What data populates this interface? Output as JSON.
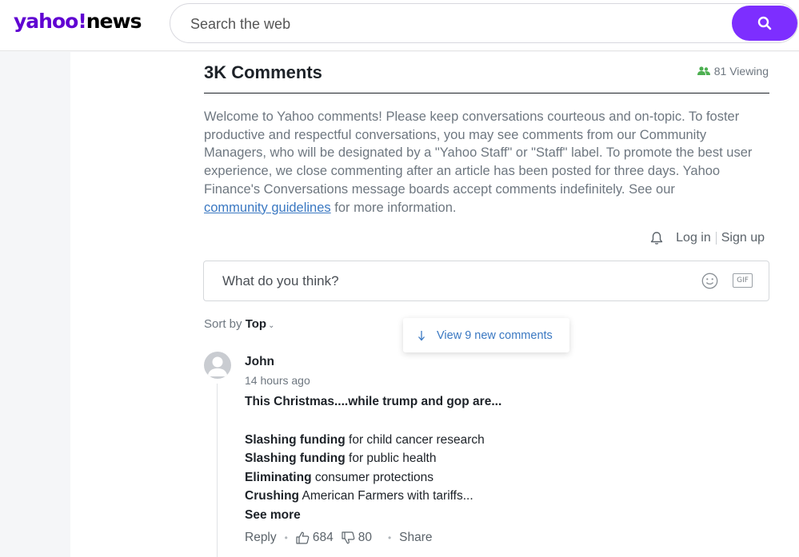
{
  "header": {
    "logo_brand": "yahoo!",
    "logo_section": "news",
    "search_placeholder": "Search the web"
  },
  "comments": {
    "title": "3K Comments",
    "viewing": "81 Viewing",
    "welcome_text": "Welcome to Yahoo comments! Please keep conversations courteous and on-topic. To foster productive and respectful conversations, you may see comments from our Community Managers, who will be designated by a \"Yahoo Staff\" or \"Staff\" label. To promote the best user experience, we close commenting after an article has been posted for three days. Yahoo Finance's Conversations message boards accept comments indefinitely. See our",
    "guidelines_link": "community guidelines",
    "welcome_suffix": "for more information.",
    "login": "Log in",
    "signup": "Sign up",
    "composer_placeholder": "What do you think?",
    "gif_label": "GIF",
    "sort_label": "Sort by",
    "sort_value": "Top",
    "new_comments": "View 9 new comments"
  },
  "comment": {
    "author": "John",
    "time": "14 hours ago",
    "line1": "This Christmas....while trump and gop are...",
    "items": [
      {
        "bold": "Slashing funding",
        "rest": "for child cancer research"
      },
      {
        "bold": "Slashing funding",
        "rest": "for public health"
      },
      {
        "bold": "Eliminating",
        "rest": "consumer protections"
      },
      {
        "bold": "Crushing",
        "rest": "American Farmers with tariffs..."
      }
    ],
    "see_more": "See more",
    "reply": "Reply",
    "upvotes": "684",
    "downvotes": "80",
    "share": "Share"
  },
  "colors": {
    "brand_purple": "#6001d2",
    "search_button": "#7d2eff",
    "link_blue": "#3a78c2",
    "viewing_green": "#4caf50"
  }
}
